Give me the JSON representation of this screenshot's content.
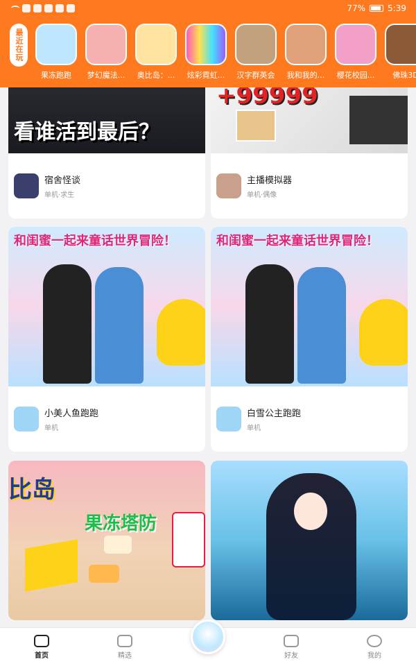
{
  "status": {
    "battery": "77%",
    "time": "5:39"
  },
  "recent": {
    "tag": "最近在玩",
    "items": [
      {
        "label": "果冻跑跑",
        "color": "#bfe6ff"
      },
      {
        "label": "梦幻魔法...",
        "color": "#f7b0b0"
      },
      {
        "label": "奥比岛：...",
        "color": "#ffe3a1"
      },
      {
        "label": "炫彩霓虹...",
        "color": "#7fd3ff"
      },
      {
        "label": "汉字群英会",
        "color": "#c2a27e"
      },
      {
        "label": "我和我的...",
        "color": "#e0a07a"
      },
      {
        "label": "樱花校园...",
        "color": "#f3a0c9"
      },
      {
        "label": "佛珠3D",
        "color": "#8a5a36"
      }
    ]
  },
  "feed": {
    "cards": [
      {
        "name": "宿舍怪谈",
        "sub": "单机·求生",
        "thumb_text": "看谁活到最后？",
        "icon_color": "#3b3f6b"
      },
      {
        "name": "主播模拟器",
        "sub": "单机·偶像",
        "thumb_text": "+99999",
        "icon_color": "#c8a08b"
      },
      {
        "name": "小美人鱼跑跑",
        "sub": "单机",
        "thumb_text": "和闺蜜一起来童话世界冒险！",
        "icon_color": "#9fd5f5"
      },
      {
        "name": "白雪公主跑跑",
        "sub": "单机",
        "thumb_text": "和闺蜜一起来童话世界冒险！",
        "icon_color": "#9fd5f5"
      },
      {
        "name": "",
        "sub": "",
        "thumb_text": "果冻塔防",
        "thumb_text2": "比岛",
        "icon_color": "#ffcc33"
      },
      {
        "name": "",
        "sub": "",
        "thumb_text": "",
        "icon_color": "#3ab8c8"
      }
    ]
  },
  "nav": {
    "home": "首页",
    "featured": "精选",
    "friends": "好友",
    "me": "我的"
  }
}
